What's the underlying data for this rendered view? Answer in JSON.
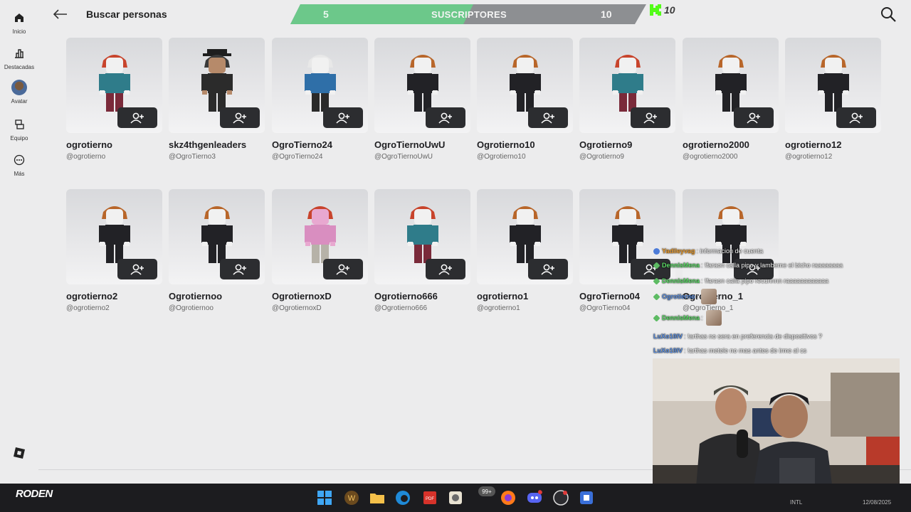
{
  "sidebar": {
    "items": [
      {
        "label": "Inicio",
        "icon": "home-icon"
      },
      {
        "label": "Destacadas",
        "icon": "chart-icon"
      },
      {
        "label": "Avatar",
        "icon": "avatar-icon"
      },
      {
        "label": "Equipo",
        "icon": "inventory-icon"
      },
      {
        "label": "Más",
        "icon": "more-icon"
      }
    ]
  },
  "header": {
    "title": "Buscar personas",
    "back_icon": "arrow-left-icon",
    "search_icon": "search-icon"
  },
  "subscriber_goal": {
    "current": "5",
    "label": "SUSCRIPTORES",
    "goal": "10",
    "kick_goal": "10",
    "progress": 0.5,
    "fill_color": "#6cc88a",
    "track_color": "#8d8f92"
  },
  "results": [
    {
      "name": "ogrotierno",
      "handle": "@ogrotierno",
      "hair": "#c8442c",
      "shirt": "#2f7c8a",
      "pants": "#7a2a3a",
      "skin": "#f1f1f1"
    },
    {
      "name": "skz4thgenleaders",
      "handle": "@OgroTierno3",
      "hair": "#3a3a3a",
      "shirt": "#2b2b2b",
      "pants": "#2b2b2b",
      "skin": "#b68a6a",
      "hat": true
    },
    {
      "name": "OgroTierno24",
      "handle": "@OgroTierno24",
      "hair": "#e8e8e8",
      "shirt": "#2f6fa8",
      "pants": "#2a2a2a",
      "skin": "#f1f1f1"
    },
    {
      "name": "OgroTiernoUwU",
      "handle": "@OgroTiernoUwU",
      "hair": "#b8662a",
      "shirt": "#222226",
      "pants": "#222226",
      "skin": "#f1f1f1"
    },
    {
      "name": "Ogrotierno10",
      "handle": "@Ogrotierno10",
      "hair": "#b8662a",
      "shirt": "#222226",
      "pants": "#222226",
      "skin": "#f1f1f1"
    },
    {
      "name": "Ogrotierno9",
      "handle": "@Ogrotierno9",
      "hair": "#c8442c",
      "shirt": "#2f7c8a",
      "pants": "#7a2a3a",
      "skin": "#f1f1f1"
    },
    {
      "name": "ogrotierno2000",
      "handle": "@ogrotierno2000",
      "hair": "#b8662a",
      "shirt": "#222226",
      "pants": "#222226",
      "skin": "#f1f1f1"
    },
    {
      "name": "ogrotierno12",
      "handle": "@ogrotierno12",
      "hair": "#b8662a",
      "shirt": "#222226",
      "pants": "#222226",
      "skin": "#f1f1f1"
    },
    {
      "name": "ogrotierno2",
      "handle": "@ogrotierno2",
      "hair": "#b8662a",
      "shirt": "#222226",
      "pants": "#222226",
      "skin": "#f1f1f1"
    },
    {
      "name": "Ogrotiernoo",
      "handle": "@Ogrotiernoo",
      "hair": "#b8662a",
      "shirt": "#222226",
      "pants": "#222226",
      "skin": "#f1f1f1"
    },
    {
      "name": "OgrotiernoxD",
      "handle": "@OgrotiernoxD",
      "hair": "#c8442c",
      "shirt": "#d98ec0",
      "pants": "#b6b2a8",
      "skin": "#e8a8d0"
    },
    {
      "name": "Ogrotierno666",
      "handle": "@Ogrotierno666",
      "hair": "#c8442c",
      "shirt": "#2f7c8a",
      "pants": "#7a2a3a",
      "skin": "#f1f1f1"
    },
    {
      "name": "ogrotierno1",
      "handle": "@ogrotierno1",
      "hair": "#b8662a",
      "shirt": "#222226",
      "pants": "#222226",
      "skin": "#f1f1f1"
    },
    {
      "name": "OgroTierno04",
      "handle": "@OgroTierno04",
      "hair": "#b8662a",
      "shirt": "#222226",
      "pants": "#222226",
      "skin": "#f1f1f1"
    },
    {
      "name": "OgroTierno_1",
      "handle": "@OgroTierno_1",
      "hair": "#b8662a",
      "shirt": "#222226",
      "pants": "#222226",
      "skin": "#f1f1f1"
    }
  ],
  "add_friend_icon": "add-friend-icon",
  "chat": [
    {
      "user": "Yadileyvag",
      "color": "#f0a030",
      "badge": "b",
      "text": ": informacion de cuenta"
    },
    {
      "user": "DennisMena",
      "color": "#5fe06a",
      "badge": "g",
      "text": ": !faraon calla pipo y lambeme el bicho raaaaaaaa"
    },
    {
      "user": "DennisMena",
      "color": "#5fe06a",
      "badge": "g",
      "text": ": !faraon calla pipo recunnnn raaaaaaaaaaaa"
    },
    {
      "user": "Ogrotierno",
      "color": "#5b8fe0",
      "badge": "g",
      "text": ":",
      "emote": true
    },
    {
      "user": "DennisMena",
      "color": "#5fe06a",
      "badge": "g",
      "text": ":",
      "emote": true
    },
    {
      "user": "LuXo10IV",
      "color": "#5b8fe0",
      "badge": "",
      "text": ": !arthas no sera en preferencia de dispositivos ?"
    },
    {
      "user": "LuXo10IV",
      "color": "#5b8fe0",
      "badge": "",
      "text": ": !arthas metele no mas antes de irme al cs"
    }
  ],
  "taskbar": {
    "streamer_logo": "RODEN",
    "notif_count": "99+",
    "lang": "INTL",
    "date": "12/08/2025"
  }
}
